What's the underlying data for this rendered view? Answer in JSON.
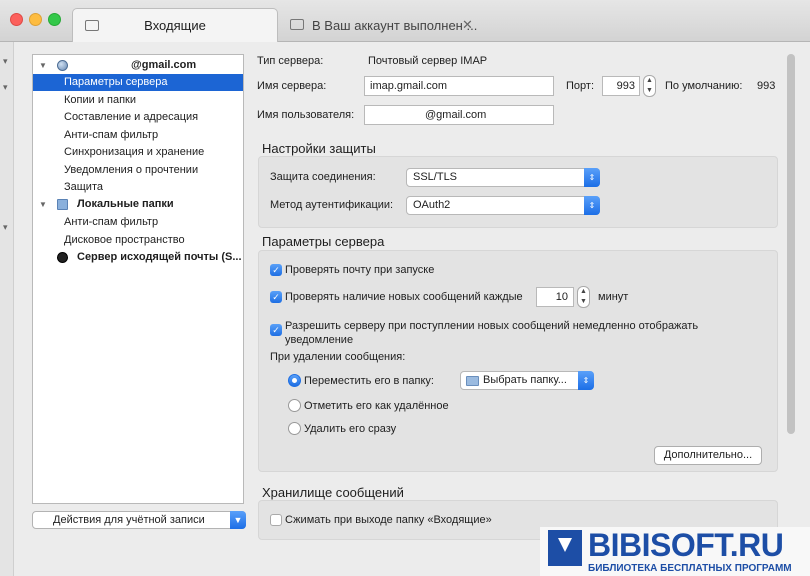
{
  "window": {
    "active_tab": "Входящие",
    "inactive_tab": "В Ваш аккаунт выполнен ...",
    "inactive_tab_close": "✕"
  },
  "tree": {
    "account": "@gmail.com",
    "items": [
      "Параметры сервера",
      "Копии и папки",
      "Составление и адресация",
      "Анти-спам фильтр",
      "Синхронизация и хранение",
      "Уведомления о прочтении",
      "Защита"
    ],
    "local_folders": "Локальные папки",
    "local_items": [
      "Анти-спам фильтр",
      "Дисковое пространство"
    ],
    "outgoing": "Сервер исходящей почты (S..."
  },
  "account_actions": "Действия для учётной записи",
  "server": {
    "type_label": "Тип сервера:",
    "type_value": "Почтовый сервер IMAP",
    "name_label": "Имя сервера:",
    "name_value": "imap.gmail.com",
    "port_label": "Порт:",
    "port_value": "993",
    "default_label": "По умолчанию:",
    "default_value": "993",
    "user_label": "Имя пользователя:",
    "user_value": "@gmail.com"
  },
  "security": {
    "title": "Настройки защиты",
    "connection_label": "Защита соединения:",
    "connection_value": "SSL/TLS",
    "auth_label": "Метод аутентификации:",
    "auth_value": "OAuth2"
  },
  "server_settings": {
    "title": "Параметры сервера",
    "check_on_start": "Проверять почту при запуске",
    "check_every": "Проверять наличие новых сообщений каждые",
    "minutes_value": "10",
    "minutes_label": "минут",
    "allow_notify": "Разрешить серверу при поступлении новых сообщений немедленно отображать уведомление",
    "on_delete_label": "При удалении сообщения:",
    "move_to_folder": "Переместить его в папку:",
    "folder_select": "Выбрать папку...",
    "mark_deleted": "Отметить его как удалённое",
    "delete_now": "Удалить его сразу",
    "advanced_button": "Дополнительно..."
  },
  "storage": {
    "title": "Хранилище сообщений",
    "compact_on_exit": "Сжимать при выходе папку «Входящие»"
  },
  "watermark": {
    "title": "BIBISOFT.RU",
    "subtitle": "БИБЛИОТЕКА БЕСПЛАТНЫХ ПРОГРАММ"
  }
}
